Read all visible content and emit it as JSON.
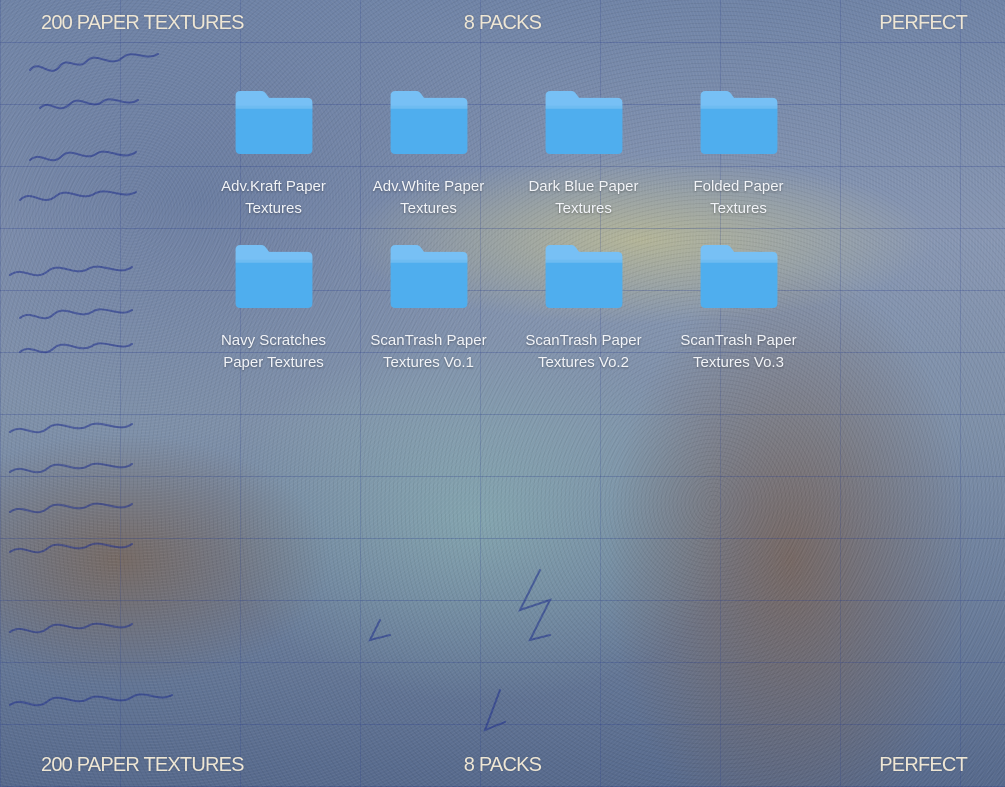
{
  "header": {
    "left": "200 PAPER TEXTURES",
    "center": "8 PACKS",
    "right": "PERFECT"
  },
  "footer": {
    "left": "200 PAPER TEXTURES",
    "center": "8 PACKS",
    "right": "PERFECT"
  },
  "icon": "folder-icon",
  "colors": {
    "folder_top": "#77c0f5",
    "folder_body": "#4faeee",
    "label_text": "#f2f4f8",
    "header_text": "#eee6d4"
  },
  "folders": [
    {
      "line1": "Adv.Kraft Paper",
      "line2": "Textures"
    },
    {
      "line1": "Adv.White Paper",
      "line2": "Textures"
    },
    {
      "line1": "Dark Blue Paper",
      "line2": "Textures"
    },
    {
      "line1": "Folded Paper",
      "line2": "Textures"
    },
    {
      "line1": "Navy Scratches",
      "line2": "Paper Textures"
    },
    {
      "line1": "ScanTrash Paper",
      "line2": "Textures Vo.1"
    },
    {
      "line1": "ScanTrash Paper",
      "line2": "Textures Vo.2"
    },
    {
      "line1": "ScanTrash Paper",
      "line2": "Textures Vo.3"
    }
  ]
}
